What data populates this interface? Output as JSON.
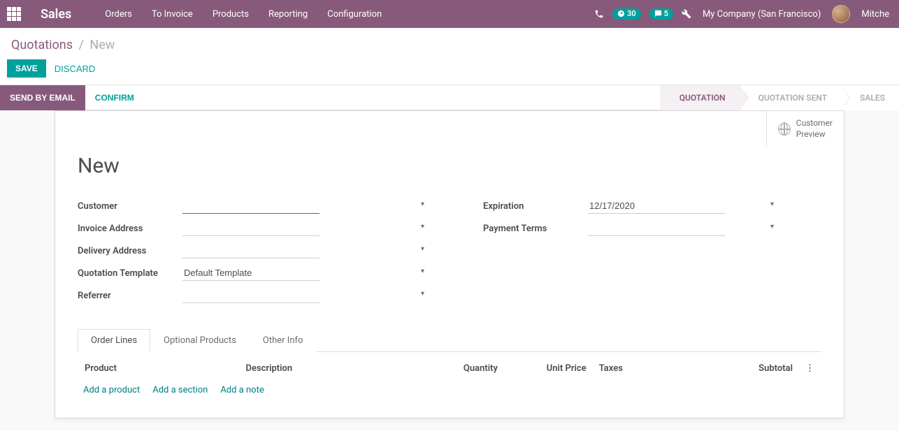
{
  "navbar": {
    "brand": "Sales",
    "menus": [
      "Orders",
      "To Invoice",
      "Products",
      "Reporting",
      "Configuration"
    ],
    "activity_count": "30",
    "message_count": "5",
    "company": "My Company (San Francisco)",
    "user": "Mitche"
  },
  "breadcrumb": {
    "root": "Quotations",
    "current": "New"
  },
  "buttons": {
    "save": "SAVE",
    "discard": "DISCARD",
    "send_email": "SEND BY EMAIL",
    "confirm": "CONFIRM"
  },
  "status": {
    "s1": "QUOTATION",
    "s2": "QUOTATION SENT",
    "s3": "SALES"
  },
  "preview": {
    "line1": "Customer",
    "line2": "Preview"
  },
  "record": {
    "title": "New",
    "labels": {
      "customer": "Customer",
      "invoice_address": "Invoice Address",
      "delivery_address": "Delivery Address",
      "quotation_template": "Quotation Template",
      "referrer": "Referrer",
      "expiration": "Expiration",
      "payment_terms": "Payment Terms"
    },
    "values": {
      "customer": "",
      "invoice_address": "",
      "delivery_address": "",
      "quotation_template": "Default Template",
      "referrer": "",
      "expiration": "12/17/2020",
      "payment_terms": ""
    }
  },
  "tabs": {
    "order_lines": "Order Lines",
    "optional_products": "Optional Products",
    "other_info": "Other Info"
  },
  "table": {
    "headers": {
      "product": "Product",
      "description": "Description",
      "quantity": "Quantity",
      "unit_price": "Unit Price",
      "taxes": "Taxes",
      "subtotal": "Subtotal"
    },
    "links": {
      "add_product": "Add a product",
      "add_section": "Add a section",
      "add_note": "Add a note"
    }
  }
}
